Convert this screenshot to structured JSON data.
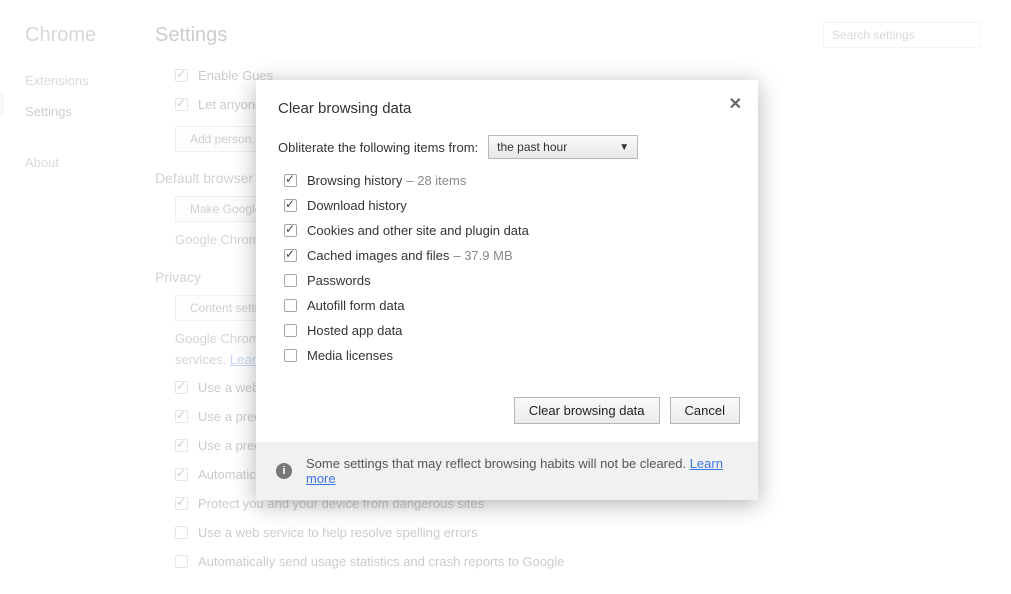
{
  "sidebar": {
    "title": "Chrome",
    "items": [
      {
        "label": "Extensions"
      },
      {
        "label": "Settings",
        "selected": true
      },
      {
        "label": "About"
      }
    ]
  },
  "header": {
    "title": "Settings",
    "search_placeholder": "Search settings"
  },
  "bg_settings": {
    "rows": [
      {
        "checked": true,
        "label": "Enable Gues"
      },
      {
        "checked": true,
        "label": "Let anyone"
      }
    ],
    "add_person_btn": "Add person…",
    "default_browser_heading": "Default browser",
    "make_default_btn": "Make Google",
    "default_browser_text": "Google Chrome",
    "privacy_heading": "Privacy",
    "content_btn": "Content settin",
    "privacy_text_1": "Google Chrome",
    "privacy_text_2": "services.",
    "privacy_learn": "Learn",
    "privacy_checks": [
      {
        "checked": true,
        "label": "Use a web s"
      },
      {
        "checked": true,
        "label": "Use a predi"
      },
      {
        "checked": true,
        "label": "Use a predi"
      },
      {
        "checked": true,
        "label": "Automatica"
      },
      {
        "checked": true,
        "label": "Protect you and your device from dangerous sites"
      },
      {
        "checked": false,
        "label": "Use a web service to help resolve spelling errors"
      },
      {
        "checked": false,
        "label": "Automatically send usage statistics and crash reports to Google"
      }
    ]
  },
  "dialog": {
    "title": "Clear browsing data",
    "from_label": "Obliterate the following items from:",
    "from_value": "the past hour",
    "options": [
      {
        "checked": true,
        "label": "Browsing history",
        "extra": "–   28 items"
      },
      {
        "checked": true,
        "label": "Download history"
      },
      {
        "checked": true,
        "label": "Cookies and other site and plugin data"
      },
      {
        "checked": true,
        "label": "Cached images and files",
        "extra": "–   37.9 MB"
      },
      {
        "checked": false,
        "label": "Passwords"
      },
      {
        "checked": false,
        "label": "Autofill form data"
      },
      {
        "checked": false,
        "label": "Hosted app data"
      },
      {
        "checked": false,
        "label": "Media licenses"
      }
    ],
    "primary_btn": "Clear browsing data",
    "cancel_btn": "Cancel",
    "info_text": "Some settings that may reflect browsing habits will not be cleared.",
    "info_link": "Learn more"
  }
}
